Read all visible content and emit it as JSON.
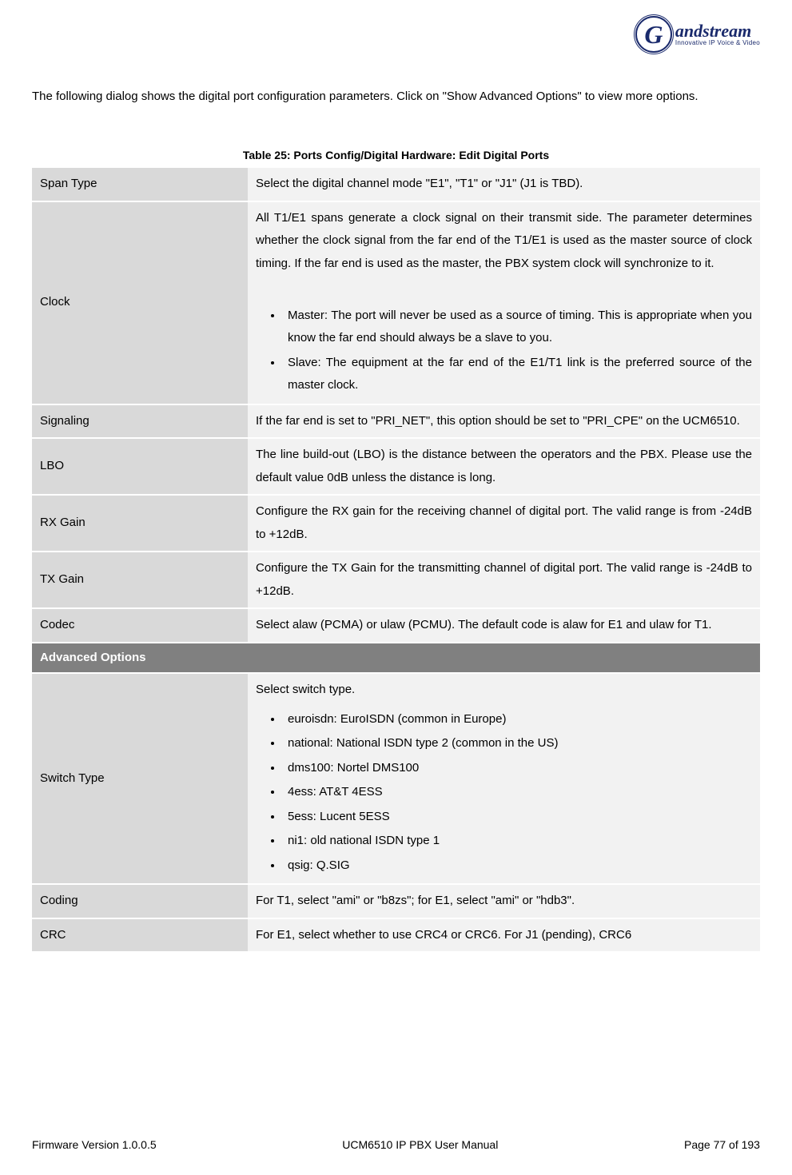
{
  "logo": {
    "letter": "G",
    "name": "andstream",
    "tagline": "Innovative IP Voice & Video"
  },
  "intro": "The following dialog shows the digital port configuration parameters. Click on \"Show Advanced Options\" to view more options.",
  "table_caption": "Table 25: Ports Config/Digital Hardware: Edit Digital Ports",
  "rows": {
    "span_type": {
      "label": "Span Type",
      "desc": "Select the digital channel mode \"E1\", \"T1\" or \"J1\" (J1 is TBD)."
    },
    "clock": {
      "label": "Clock",
      "desc": "All T1/E1 spans generate a clock signal on their transmit side. The parameter determines whether the clock signal from the far end of the T1/E1 is used as the master source of clock timing. If the far end is used as the master, the PBX system clock will synchronize to it.",
      "bullets": [
        "Master: The port will never be used as a source of timing. This is appropriate when you know the far end should always be a slave to you.",
        "Slave: The equipment at the far end of the E1/T1 link is the preferred source of the master clock."
      ]
    },
    "signaling": {
      "label": "Signaling",
      "desc": "If the far end is set to \"PRI_NET\", this option should be set to \"PRI_CPE\" on the UCM6510."
    },
    "lbo": {
      "label": "LBO",
      "desc": "The line build-out (LBO) is the distance between the operators and the PBX. Please use the default value 0dB unless the distance is long."
    },
    "rx_gain": {
      "label": "RX Gain",
      "desc": "Configure the RX gain for the receiving channel of digital port. The valid range is from -24dB to +12dB."
    },
    "tx_gain": {
      "label": "TX Gain",
      "desc": "Configure the TX Gain for the transmitting channel of digital port. The valid range is -24dB to +12dB."
    },
    "codec": {
      "label": "Codec",
      "desc": "Select alaw (PCMA) or ulaw (PCMU). The default code is alaw for E1 and ulaw for T1."
    },
    "advanced_section": "Advanced Options",
    "switch_type": {
      "label": "Switch Type",
      "desc": "Select switch type.",
      "bullets": [
        "euroisdn: EuroISDN (common in Europe)",
        "national: National ISDN   type 2 (common in the US)",
        "dms100: Nortel DMS100",
        "4ess: AT&T 4ESS",
        "5ess: Lucent 5ESS",
        "ni1: old national ISDN type 1",
        "qsig: Q.SIG"
      ]
    },
    "coding": {
      "label": "Coding",
      "desc": "For T1, select \"ami\" or \"b8zs\"; for E1, select \"ami\" or \"hdb3\"."
    },
    "crc": {
      "label": "CRC",
      "desc": "For E1, select whether to use CRC4 or CRC6. For J1 (pending), CRC6"
    }
  },
  "footer": {
    "left": "Firmware Version 1.0.0.5",
    "center": "UCM6510 IP PBX User Manual",
    "right": "Page 77 of 193"
  }
}
